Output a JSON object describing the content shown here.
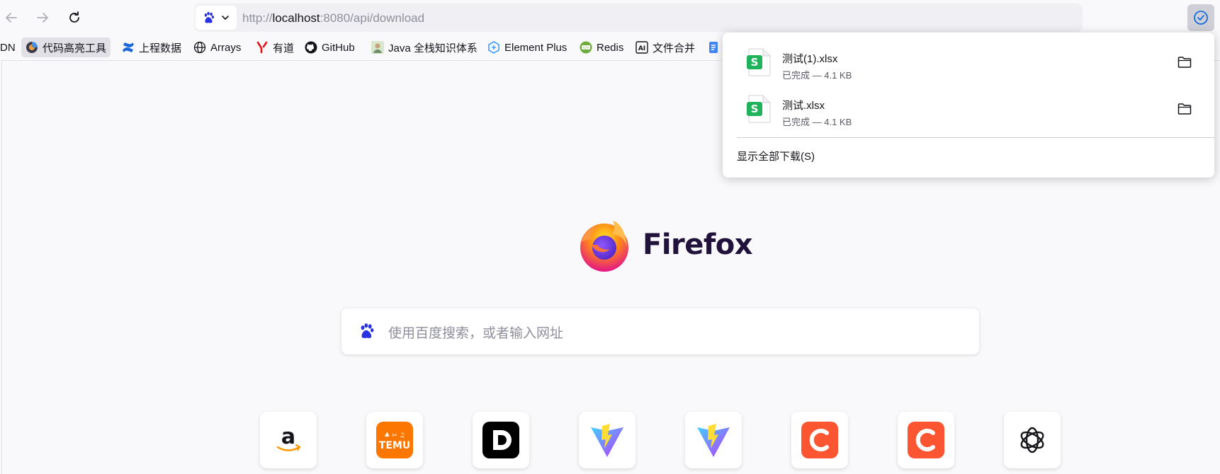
{
  "toolbar": {
    "url_prefix": "http://",
    "url_host": "localhost",
    "url_rest": ":8080/api/download"
  },
  "bookmarks": [
    {
      "label": "DN",
      "icon": "none"
    },
    {
      "label": "代码高亮工具",
      "icon": "highlight-tool-icon"
    },
    {
      "label": "上程数据",
      "icon": "confluence-icon"
    },
    {
      "label": "Arrays",
      "icon": "globe-icon"
    },
    {
      "label": "有道",
      "icon": "youdao-icon"
    },
    {
      "label": "GitHub",
      "icon": "github-icon"
    },
    {
      "label": "Java 全栈知识体系",
      "icon": "java-avatar-icon"
    },
    {
      "label": "Element Plus",
      "icon": "element-plus-icon"
    },
    {
      "label": "Redis",
      "icon": "redis-icon"
    },
    {
      "label": "文件合并",
      "icon": "ai-icon"
    },
    {
      "label": "",
      "icon": "docs-icon"
    }
  ],
  "newtab": {
    "brand": "Firefox",
    "search_placeholder": "使用百度搜索，或者输入网址",
    "shortcuts": [
      "amazon",
      "temu",
      "dogfood",
      "vite",
      "vite",
      "csdn",
      "csdn",
      "openai"
    ]
  },
  "downloads": {
    "items": [
      {
        "name": "测试(1).xlsx",
        "status": "已完成 — 4.1 KB"
      },
      {
        "name": "测试.xlsx",
        "status": "已完成 — 4.1 KB"
      }
    ],
    "show_all": "显示全部下载(S)"
  },
  "colors": {
    "accent": "#0061e0",
    "firefox_purple": "#20123a",
    "wps_green": "#1fb35b"
  }
}
